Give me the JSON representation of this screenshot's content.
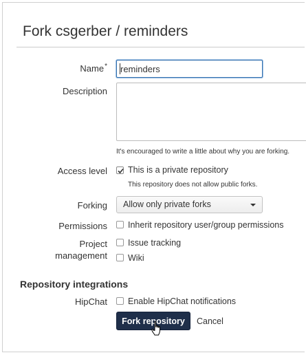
{
  "page": {
    "title": "Fork csgerber / reminders"
  },
  "form": {
    "name": {
      "label": "Name",
      "required_marker": "*",
      "value": "reminders"
    },
    "description": {
      "label": "Description",
      "value": "",
      "help": "It's encouraged to write a little about why you are forking."
    },
    "access_level": {
      "label": "Access level",
      "checkbox_label": "This is a private repository",
      "checked": true,
      "help": "This repository does not allow public forks."
    },
    "forking": {
      "label": "Forking",
      "selected": "Allow only private forks"
    },
    "permissions": {
      "label": "Permissions",
      "checkbox_label": "Inherit repository user/group permissions",
      "checked": false
    },
    "project_management": {
      "label_line1": "Project",
      "label_line2": "management",
      "options": [
        {
          "label": "Issue tracking",
          "checked": false
        },
        {
          "label": "Wiki",
          "checked": false
        }
      ]
    }
  },
  "integrations": {
    "heading": "Repository integrations",
    "hipchat": {
      "label": "HipChat",
      "checkbox_label": "Enable HipChat notifications",
      "checked": false
    }
  },
  "actions": {
    "submit_label": "Fork repository",
    "cancel_label": "Cancel"
  },
  "colors": {
    "primary_button": "#1f2f4a",
    "focus_border": "#3572b0"
  }
}
